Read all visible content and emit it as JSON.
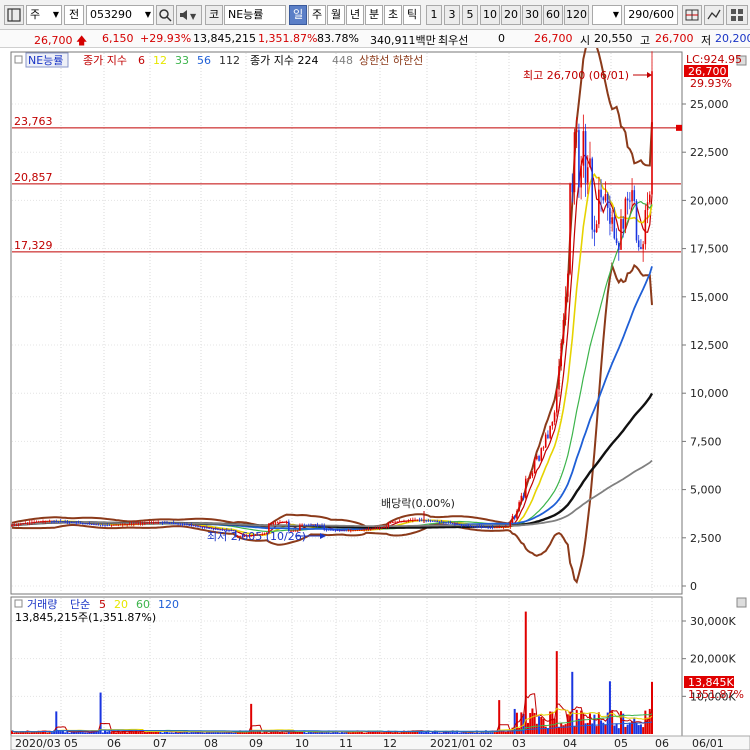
{
  "toolbar": {
    "period_prefix": "주",
    "prev_label": "전",
    "code": "053290",
    "market_label": "코",
    "stock_name": "NE능률",
    "period_tabs": [
      "일",
      "주",
      "월",
      "년",
      "분",
      "초",
      "틱"
    ],
    "active_tab": "일",
    "intervals": [
      "1",
      "3",
      "5",
      "10",
      "20",
      "30",
      "60",
      "120"
    ],
    "count": "290",
    "count_max": "/600"
  },
  "quote": {
    "price": "26,700",
    "change": "6,150",
    "change_pct": "+29.93%",
    "volume": "13,845,215",
    "volume_ratio": "1,351.87%",
    "turnover": "83.78%",
    "amount": "340,911백만",
    "priority_label": "최우선",
    "priority_value": "0",
    "bid": "26,700",
    "open_label": "시",
    "open": "20,550",
    "high_label": "고",
    "high": "26,700",
    "low_label": "저",
    "low": "20,200"
  },
  "icons": [
    "chart-type-icon",
    "dropdown-arrow-icon",
    "search-icon",
    "sound-icon",
    "dropdown-arrow-icon",
    "grid-icon",
    "line-tool-icon",
    "multi-chart-icon",
    "layout-icon"
  ],
  "chart_data": [
    {
      "type": "line",
      "subtype": "candlestick",
      "legend": {
        "tag": "NE능률",
        "ma_label": "종가 지수",
        "ma_periods": [
          6,
          12,
          33,
          56,
          112
        ],
        "ma_colors": [
          "#c00000",
          "#e6e600",
          "#3cb44b",
          "#1f5fd6",
          "#303030"
        ],
        "ma2_label": "종가 지수",
        "ma2_periods": [
          224,
          448
        ],
        "ma2_colors": [
          "#000000",
          "#7f7f7f"
        ],
        "band_label": "상한선 하한선",
        "band_color": "#8b3a1a"
      },
      "x_labels": [
        "2020/03",
        "05",
        "06",
        "07",
        "08",
        "09",
        "10",
        "11",
        "12",
        "2021/01",
        "02",
        "03",
        "04",
        "05",
        "06",
        "06/01"
      ],
      "y_ticks": [
        "25,000",
        "22,500",
        "20,000",
        "17,500",
        "15,000",
        "12,500",
        "10,000",
        "7,500",
        "5,000",
        "2,500",
        "0"
      ],
      "ylim": [
        0,
        27000
      ],
      "h_lines": [
        {
          "label": "23,763",
          "value": 23763
        },
        {
          "label": "20,857",
          "value": 20857
        },
        {
          "label": "17,329",
          "value": 17329
        }
      ],
      "annotations": {
        "high": "최고 26,700 (06/01)",
        "low": "최저 2,605 (10/26)",
        "dividend": "배당락(0.00%)",
        "lc": "LC:924.95",
        "price": "26,700",
        "price_pct": "29.93%"
      },
      "ohlc_summary": {
        "period_1": {
          "months": "2020/03 - 2021/02",
          "price_range": [
            2605,
            3800
          ]
        },
        "march_2021": {
          "price_range": [
            3200,
            10500
          ]
        },
        "april_2021": {
          "price_range": [
            14000,
            25000
          ]
        },
        "may_2021": {
          "price_range": [
            16500,
            22000
          ]
        },
        "last_close": 26700
      },
      "series": [
        {
          "name": "6",
          "values_approx": [
            3200,
            3100,
            3000,
            3050,
            3300,
            3000,
            2800,
            2900,
            2950,
            3000,
            3100,
            7500,
            21000,
            19000,
            24500
          ]
        },
        {
          "name": "12",
          "values_approx": [
            3250,
            3100,
            3050,
            3000,
            3250,
            3050,
            2850,
            2900,
            2950,
            3000,
            3050,
            6500,
            16500,
            19500,
            18500
          ]
        },
        {
          "name": "33",
          "values_approx": [
            3300,
            3150,
            3100,
            3000,
            3150,
            3100,
            2950,
            2900,
            2950,
            3000,
            3000,
            4500,
            11000,
            15000,
            16500
          ]
        },
        {
          "name": "56",
          "values_approx": [
            3300,
            3200,
            3100,
            3050,
            3100,
            3100,
            3000,
            2950,
            2950,
            2950,
            3000,
            3800,
            7500,
            10500,
            12600
          ]
        },
        {
          "name": "112",
          "values_approx": [
            3400,
            3300,
            3200,
            3100,
            3100,
            3100,
            3050,
            3000,
            3000,
            3000,
            3000,
            3200,
            5000,
            7000,
            8900
          ]
        },
        {
          "name": "224",
          "values_approx": [
            3300,
            3300,
            3250,
            3200,
            3150,
            3100,
            3100,
            3050,
            3050,
            3050,
            3050,
            3150,
            3700,
            5200,
            6300
          ]
        }
      ]
    },
    {
      "type": "bar",
      "title": "거래량",
      "legend": {
        "ma_label": "단순",
        "ma_periods": [
          5,
          20,
          60,
          120
        ],
        "ma_colors": [
          "#c00000",
          "#e6e600",
          "#3cb44b",
          "#1f5fd6"
        ]
      },
      "current": "13,845,215주(1,351.87%)",
      "y_ticks": [
        "30,000K",
        "20,000K",
        "10,000K"
      ],
      "ylim": [
        0,
        33000
      ],
      "tag_value": "13,845K",
      "tag_pct": "1351.87%",
      "peaks": [
        {
          "month": "2020/03",
          "value": 6000
        },
        {
          "month": "05",
          "value": 11000
        },
        {
          "month": "08",
          "value": 8000
        },
        {
          "month": "2021/01",
          "value": 9000
        },
        {
          "month": "03",
          "value": 32500
        },
        {
          "month": "04",
          "value": 16500
        },
        {
          "month": "05",
          "value": 14000
        },
        {
          "month": "06",
          "value": 13845
        }
      ]
    }
  ]
}
